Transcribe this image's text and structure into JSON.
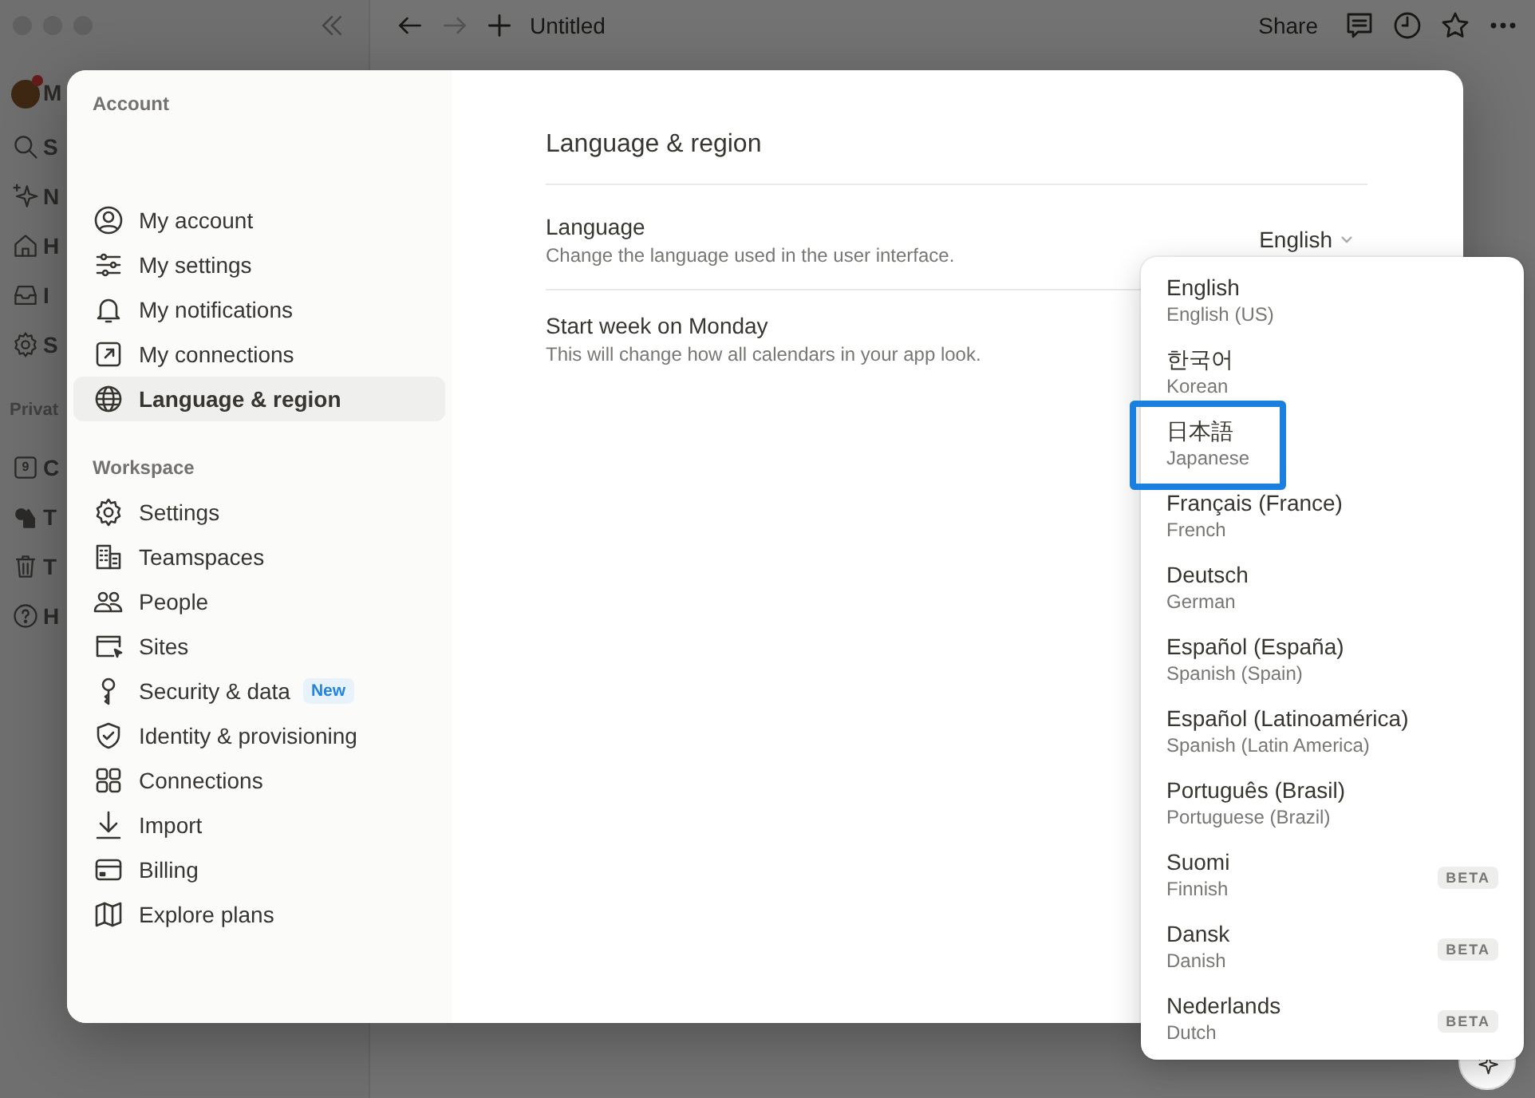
{
  "topbar": {
    "page_title": "Untitled",
    "share": "Share"
  },
  "sidebar": {
    "items": [
      {
        "label": "M",
        "notification": true
      },
      {
        "label": "S"
      },
      {
        "label": "N"
      },
      {
        "label": "H"
      },
      {
        "label": "I"
      },
      {
        "label": "S"
      }
    ],
    "section": "Privat",
    "private_items": [
      {
        "label": "C",
        "icon_text": "9"
      },
      {
        "label": "T"
      },
      {
        "label": "T"
      },
      {
        "label": "H"
      }
    ]
  },
  "settings_nav": {
    "sections": [
      {
        "title": "Account",
        "items": [
          {
            "label": "My account",
            "selected": false
          },
          {
            "label": "My settings",
            "selected": false
          },
          {
            "label": "My notifications",
            "selected": false
          },
          {
            "label": "My connections",
            "selected": false
          },
          {
            "label": "Language & region",
            "selected": true
          }
        ]
      },
      {
        "title": "Workspace",
        "items": [
          {
            "label": "Settings",
            "selected": false
          },
          {
            "label": "Teamspaces",
            "selected": false
          },
          {
            "label": "People",
            "selected": false
          },
          {
            "label": "Sites",
            "selected": false
          },
          {
            "label": "Security & data",
            "selected": false,
            "badge": "New"
          },
          {
            "label": "Identity & provisioning",
            "selected": false
          },
          {
            "label": "Connections",
            "selected": false
          },
          {
            "label": "Import",
            "selected": false
          },
          {
            "label": "Billing",
            "selected": false
          },
          {
            "label": "Explore plans",
            "selected": false
          }
        ]
      }
    ]
  },
  "content": {
    "heading": "Language & region",
    "rows": [
      {
        "title": "Language",
        "description": "Change the language used in the user interface.",
        "value": "English"
      },
      {
        "title": "Start week on Monday",
        "description": "This will change how all calendars in your app look."
      }
    ]
  },
  "language_menu": {
    "options": [
      {
        "name": "English",
        "subtitle": "English (US)",
        "highlighted": false
      },
      {
        "name": "한국어",
        "subtitle": "Korean",
        "highlighted": false
      },
      {
        "name": "日本語",
        "subtitle": "Japanese",
        "highlighted": true
      },
      {
        "name": "Français (France)",
        "subtitle": "French",
        "highlighted": false
      },
      {
        "name": "Deutsch",
        "subtitle": "German",
        "highlighted": false
      },
      {
        "name": "Español (España)",
        "subtitle": "Spanish (Spain)",
        "highlighted": false
      },
      {
        "name": "Español (Latinoamérica)",
        "subtitle": "Spanish (Latin America)",
        "highlighted": false
      },
      {
        "name": "Português (Brasil)",
        "subtitle": "Portuguese (Brazil)",
        "highlighted": false
      },
      {
        "name": "Suomi",
        "subtitle": "Finnish",
        "badge": "BETA",
        "highlighted": false
      },
      {
        "name": "Dansk",
        "subtitle": "Danish",
        "badge": "BETA",
        "highlighted": false
      },
      {
        "name": "Nederlands",
        "subtitle": "Dutch",
        "badge": "BETA",
        "highlighted": false
      }
    ]
  }
}
